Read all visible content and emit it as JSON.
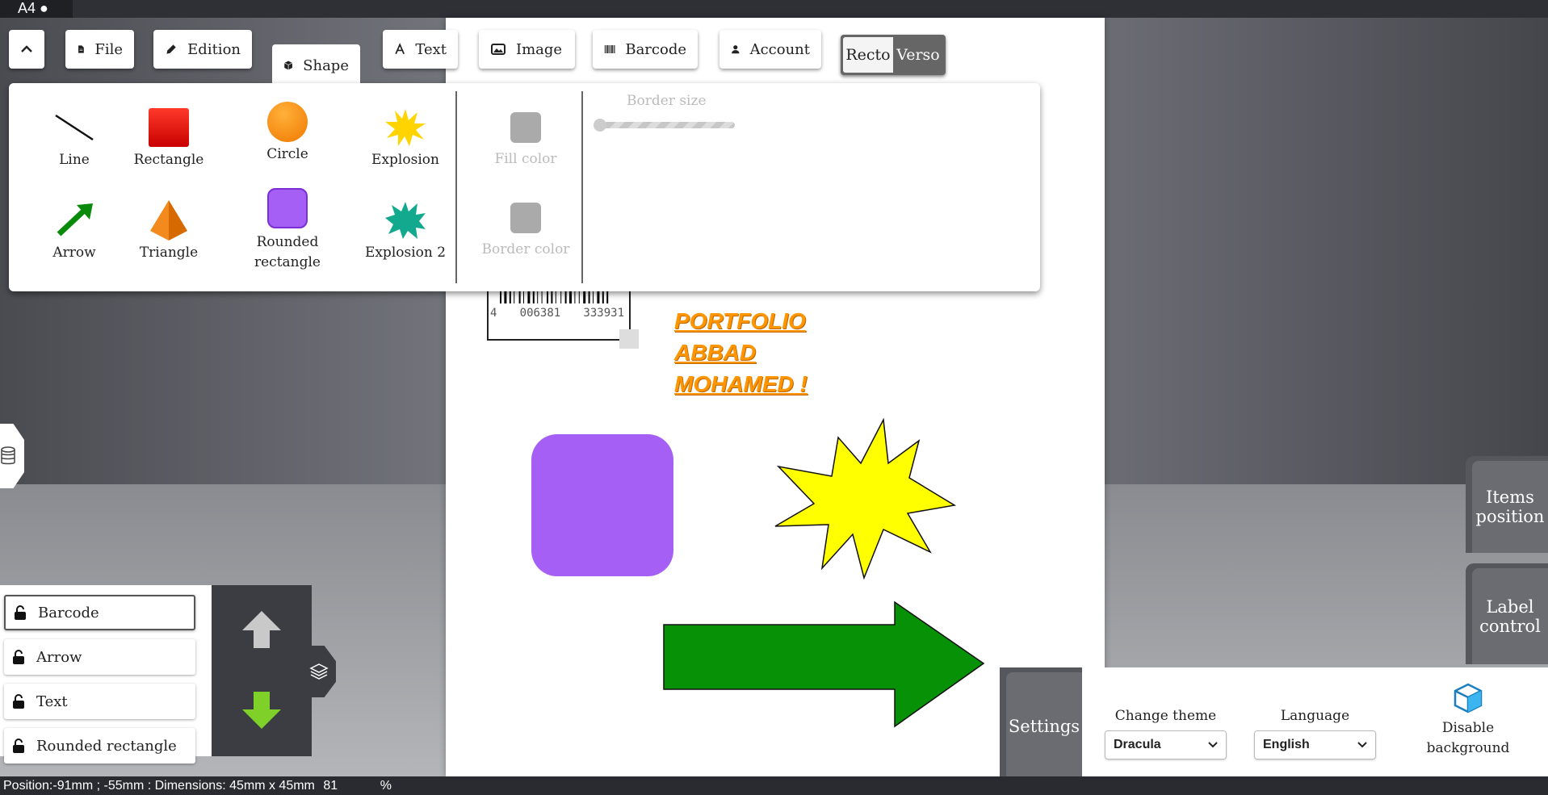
{
  "document_tag": "A4 ●",
  "toolbar": {
    "collapse_icon": "chevron-up-icon",
    "file": "File",
    "edition": "Edition",
    "shape": "Shape",
    "text": "Text",
    "image": "Image",
    "barcode": "Barcode",
    "account": "Account",
    "recto": "Recto",
    "verso": "Verso"
  },
  "shape_panel": {
    "shapes": [
      "Line",
      "Rectangle",
      "Circle",
      "Explosion",
      "Arrow",
      "Triangle",
      "Rounded rectangle",
      "Explosion 2"
    ],
    "fill_color": "Fill color",
    "border_color": "Border color",
    "border_size": "Border size",
    "border_size_value": 0
  },
  "canvas": {
    "barcode_digits": [
      "4",
      "006381",
      "333931"
    ],
    "text_lines": [
      "PORTFOLIO",
      "ABBAD",
      "MOHAMED !"
    ],
    "colors": {
      "rounded_rect": "#a55ff5",
      "explosion": "#ffff00",
      "arrow": "#069106",
      "text": "#ff9500"
    }
  },
  "layers": {
    "items": [
      "Barcode",
      "Arrow",
      "Text",
      "Rounded rectangle"
    ],
    "selected": "Barcode"
  },
  "side_tabs": {
    "items_position": "Items position",
    "label_control": "Label control"
  },
  "settings": {
    "tab": "Settings",
    "theme_label": "Change theme",
    "theme_value": "Dracula",
    "language_label": "Language",
    "language_value": "English",
    "disable_background": "Disable background"
  },
  "status": {
    "position": "Position:-91mm ; -55mm : Dimensions: 45mm x 45mm",
    "zoom": "81",
    "percent": "%"
  }
}
